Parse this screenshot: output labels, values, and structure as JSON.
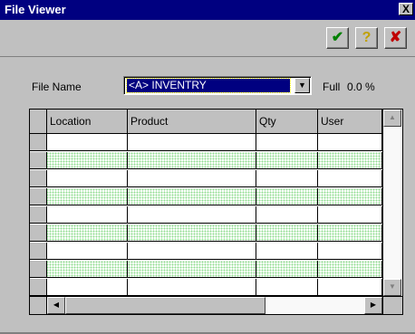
{
  "window": {
    "title": "File Viewer",
    "close_label": "X"
  },
  "toolbar": {
    "ok_icon": "checkmark-icon",
    "ok_glyph": "✔",
    "help_icon": "question-icon",
    "help_glyph": "?",
    "cancel_icon": "cross-icon",
    "cancel_glyph": "✘",
    "ok_color": "#008000",
    "help_color": "#c0a000",
    "cancel_color": "#c00000"
  },
  "form": {
    "file_name_label": "File Name",
    "file_name_value": "<A> INVENTRY",
    "full_label": "Full",
    "full_value": "0.0 %"
  },
  "table": {
    "columns": [
      "Location",
      "Product",
      "Qty",
      "User"
    ],
    "rows": [
      {
        "Location": "",
        "Product": "",
        "Qty": "",
        "User": ""
      },
      {
        "Location": "",
        "Product": "",
        "Qty": "",
        "User": ""
      },
      {
        "Location": "",
        "Product": "",
        "Qty": "",
        "User": ""
      },
      {
        "Location": "",
        "Product": "",
        "Qty": "",
        "User": ""
      },
      {
        "Location": "",
        "Product": "",
        "Qty": "",
        "User": ""
      },
      {
        "Location": "",
        "Product": "",
        "Qty": "",
        "User": ""
      },
      {
        "Location": "",
        "Product": "",
        "Qty": "",
        "User": ""
      },
      {
        "Location": "",
        "Product": "",
        "Qty": "",
        "User": ""
      },
      {
        "Location": "",
        "Product": "",
        "Qty": "",
        "User": ""
      },
      {
        "Location": "",
        "Product": "",
        "Qty": "",
        "User": ""
      }
    ],
    "alt_row_color": "#8fdc8f"
  },
  "scroll": {
    "up_glyph": "▲",
    "down_glyph": "▼",
    "left_glyph": "◀",
    "right_glyph": "▶",
    "dropdown_glyph": "▼"
  }
}
